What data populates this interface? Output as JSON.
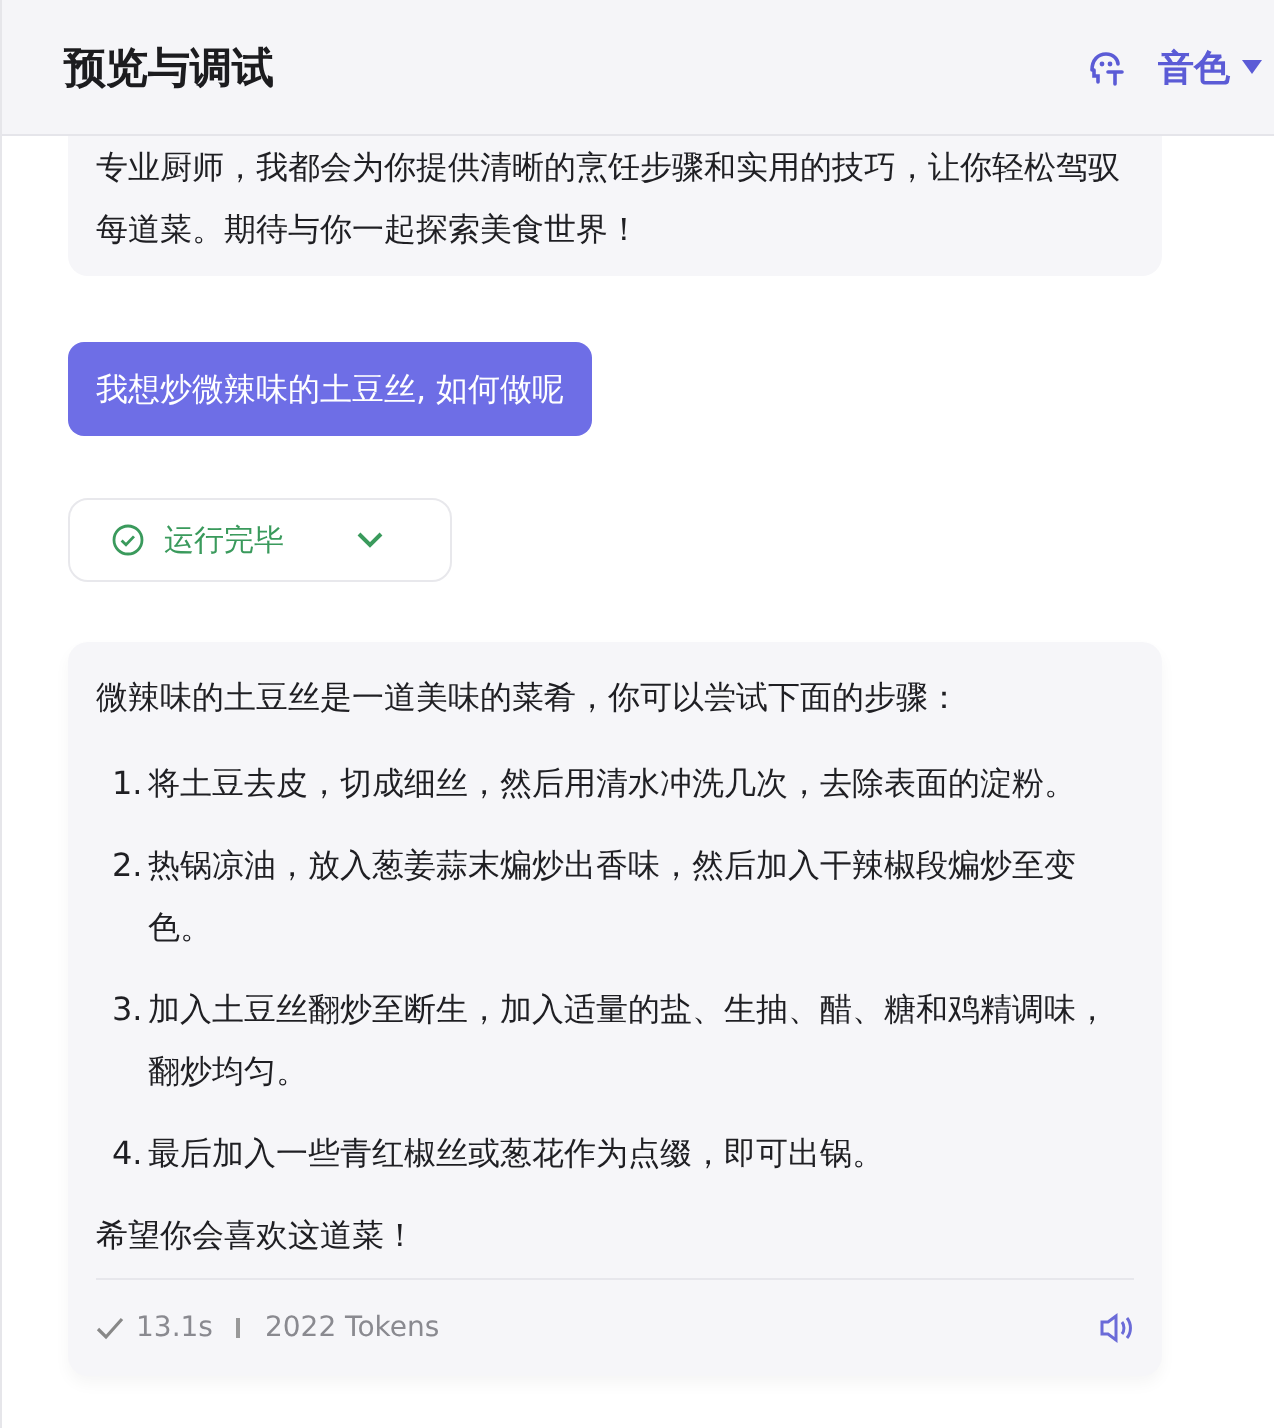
{
  "header": {
    "title": "预览与调试",
    "voice_button": "音色"
  },
  "messages": [
    {
      "kind": "bot_text",
      "text": "专业厨师，我都会为你提供清晰的烹饪步骤和实用的技巧，让你轻松驾驭每道菜。期待与你一起探索美食世界！"
    },
    {
      "kind": "user",
      "text": "我想炒微辣味的土豆丝, 如何做呢"
    },
    {
      "kind": "status",
      "label": "运行完毕",
      "expanded": false
    },
    {
      "kind": "answer",
      "intro": "微辣味的土豆丝是一道美味的菜肴，你可以尝试下面的步骤：",
      "steps": [
        {
          "marker": "1.",
          "text": "将土豆去皮，切成细丝，然后用清水冲洗几次，去除表面的淀粉。"
        },
        {
          "marker": "2.",
          "text": "热锅凉油，放入葱姜蒜末煸炒出香味，然后加入干辣椒段煸炒至变色。"
        },
        {
          "marker": "3.",
          "text": "加入土豆丝翻炒至断生，加入适量的盐、生抽、醋、糖和鸡精调味，翻炒均匀。"
        },
        {
          "marker": "4.",
          "text": "最后加入一些青红椒丝或葱花作为点缀，即可出锅。"
        }
      ],
      "closing": "希望你会喜欢这道菜！",
      "duration": "13.1s",
      "tokens": "2022 Tokens"
    }
  ]
}
